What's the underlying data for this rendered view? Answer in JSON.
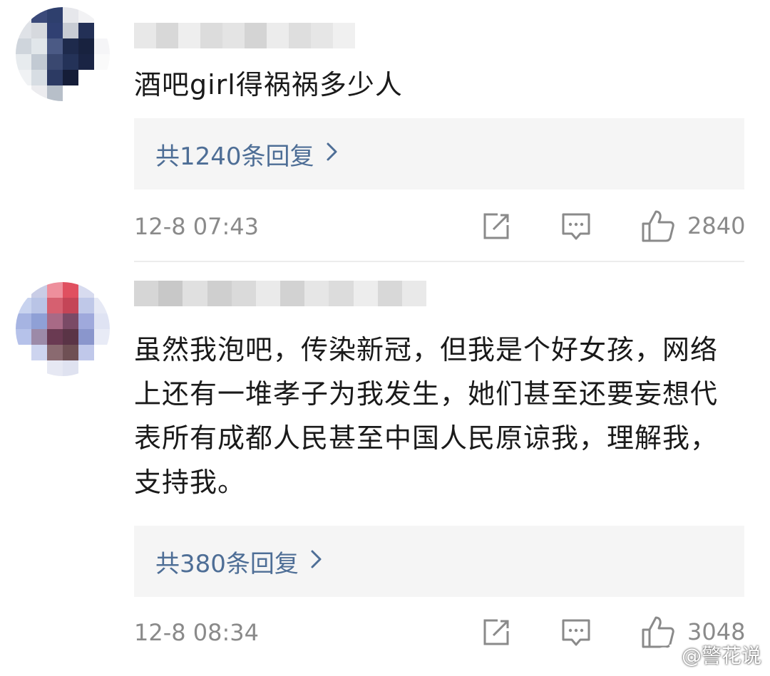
{
  "comments": [
    {
      "text": "酒吧girl得祸祸多少人",
      "replies_label": "共1240条回复",
      "time": "12-8 07:43",
      "likes": "2840"
    },
    {
      "text": "虽然我泡吧，传染新冠，但我是个好女孩，网络上还有一堆孝子为我发生，她们甚至还要妄想代表所有成都人民甚至中国人民原谅我，理解我，支持我。",
      "replies_label": "共380条回复",
      "time": "12-8 08:34",
      "likes": "3048"
    }
  ],
  "icons": {
    "share": "share-icon",
    "comment": "comment-icon",
    "like": "thumbs-up-icon",
    "chevron": "chevron-right-icon",
    "weibo": "weibo-logo-icon"
  },
  "colors": {
    "link": "#4e6e96",
    "meta": "#8a8a8a",
    "reply_bg": "#f5f5f5",
    "text": "#1a1a1a"
  },
  "watermark": "@警花说"
}
